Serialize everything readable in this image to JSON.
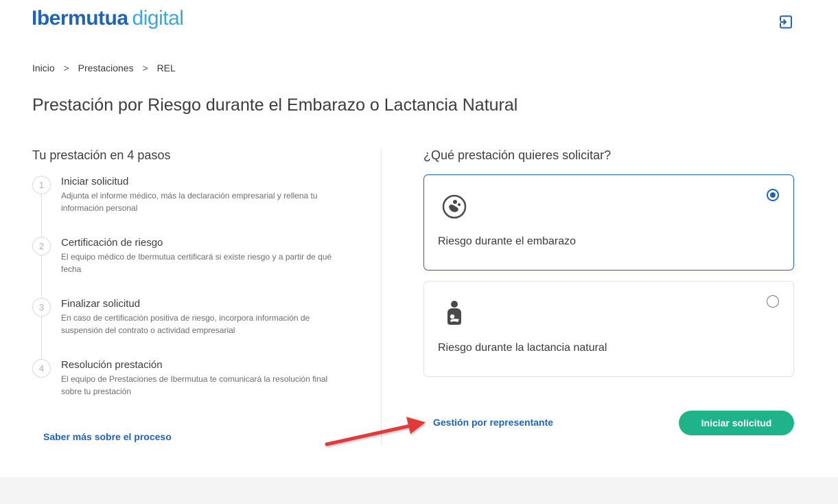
{
  "header": {
    "logo_brand": "Ibermutua",
    "logo_product": "digital",
    "logout_icon": "logout-icon"
  },
  "breadcrumb": {
    "items": [
      "Inicio",
      "Prestaciones",
      "REL"
    ],
    "separator": ">"
  },
  "page_title": "Prestación por Riesgo durante el Embarazo o Lactancia Natural",
  "steps_section": {
    "title": "Tu prestación en 4 pasos",
    "steps": [
      {
        "number": "1",
        "title": "Iniciar solicitud",
        "description": "Adjunta el informe médico, más la declaración empresarial y rellena tu información personal"
      },
      {
        "number": "2",
        "title": "Certificación de riesgo",
        "description": "El equipo médico de Ibermutua certificará si existe riesgo y a partir de qué fecha"
      },
      {
        "number": "3",
        "title": "Finalizar solicitud",
        "description": "En caso de certificación positiva de riesgo, incorpora información de suspensión del contrato o actividad empresarial"
      },
      {
        "number": "4",
        "title": "Resolución prestación",
        "description": "El equipo de Prestaciones de Ibermutua te comunicará la resolución final sobre tu prestación"
      }
    ],
    "more_link": "Saber más sobre el proceso"
  },
  "selection": {
    "question": "¿Qué prestación quieres solicitar?",
    "options": [
      {
        "label": "Riesgo durante el embarazo",
        "icon": "pregnancy-icon",
        "selected": true
      },
      {
        "label": "Riesgo durante la lactancia natural",
        "icon": "breastfeeding-icon",
        "selected": false
      }
    ],
    "representative_link": "Gestión por representante",
    "start_button": "Iniciar solicitud"
  },
  "colors": {
    "brand_blue": "#1f63b8",
    "brand_light_blue": "#3ba7d6",
    "button_green": "#1fb38a",
    "annotation_red": "#e5393a"
  }
}
